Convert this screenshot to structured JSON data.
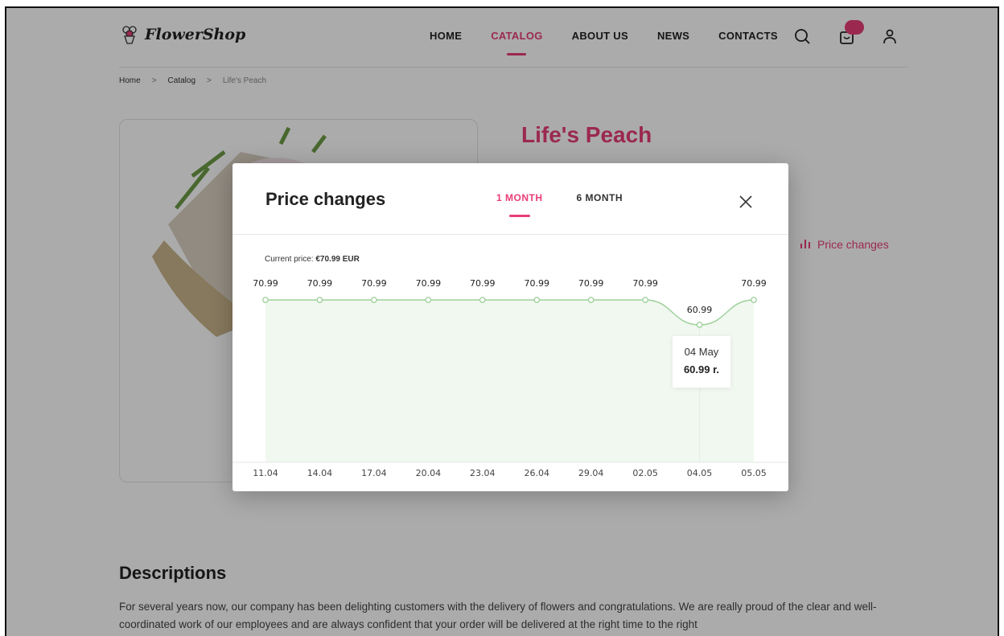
{
  "header": {
    "logo_text": "FlowerShop",
    "nav": [
      "HOME",
      "CATALOG",
      "ABOUT US",
      "NEWS",
      "CONTACTS"
    ],
    "active_nav": "CATALOG",
    "icons": [
      "search-icon",
      "cart-icon",
      "user-icon"
    ]
  },
  "breadcrumb": {
    "home": "Home",
    "sep": ">",
    "catalog": "Catalog",
    "current": "Life's Peach"
  },
  "product": {
    "title": "Life's Peach",
    "price_changes_link": "Price changes"
  },
  "description": {
    "title": "Descriptions",
    "text": "For several years now, our company has been delighting customers with the delivery of flowers and congratulations. We are really proud of the clear and well-coordinated work of our employees and are always confident that your order will be delivered at the right time to the right"
  },
  "modal": {
    "title": "Price changes",
    "tabs": [
      "1 MONTH",
      "6 MONTH"
    ],
    "active_tab": "1 MONTH",
    "current_price_label": "Current price:",
    "current_price_value": "€70.99 EUR",
    "tooltip": {
      "date": "04 May",
      "value": "60.99 r."
    }
  },
  "colors": {
    "accent": "#e83e76",
    "line": "#9fd09c",
    "area": "#f1f8f0"
  },
  "chart_data": {
    "type": "area",
    "x": [
      "11.04",
      "14.04",
      "17.04",
      "20.04",
      "23.04",
      "26.04",
      "29.04",
      "02.05",
      "04.05",
      "05.05"
    ],
    "values": [
      70.99,
      70.99,
      70.99,
      70.99,
      70.99,
      70.99,
      70.99,
      70.99,
      60.99,
      70.99
    ],
    "data_labels": [
      "70.99",
      "70.99",
      "70.99",
      "70.99",
      "70.99",
      "70.99",
      "70.99",
      "70.99",
      "60.99",
      "70.99"
    ],
    "highlighted_point": "04.05",
    "grid": false,
    "legend": "none"
  }
}
